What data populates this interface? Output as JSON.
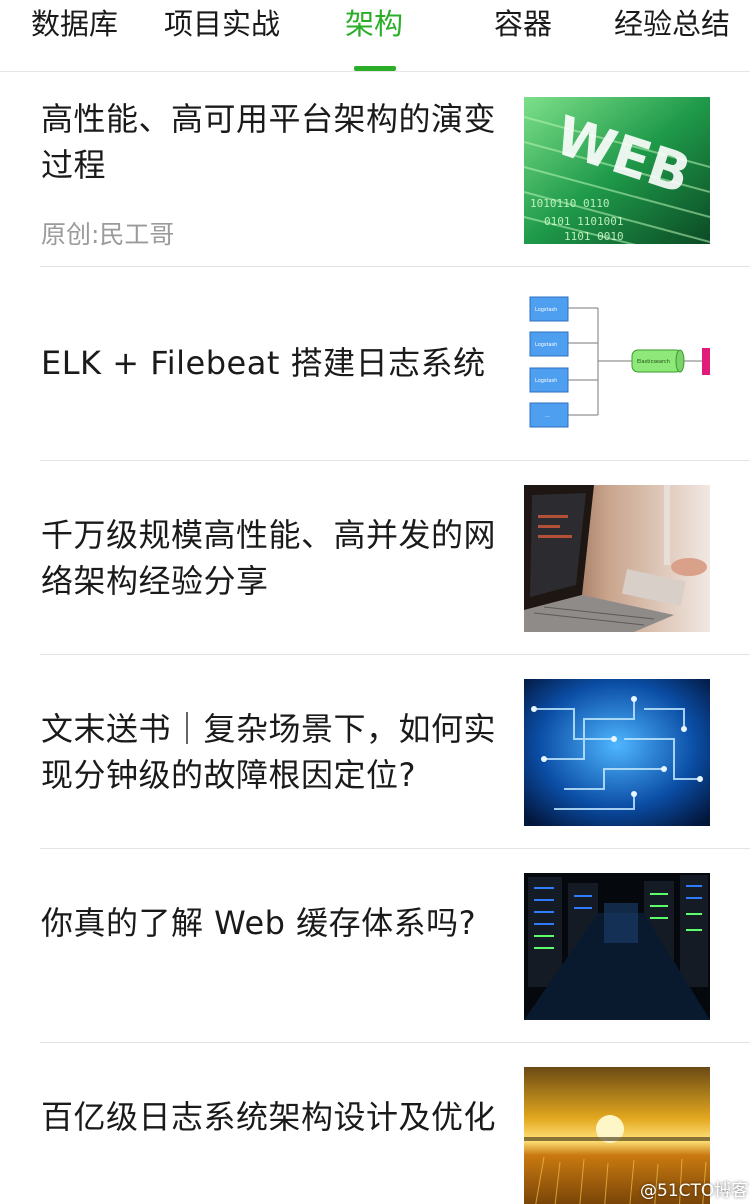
{
  "tabs": [
    {
      "label": "数据库",
      "active": false
    },
    {
      "label": "项目实战",
      "active": false
    },
    {
      "label": "架构",
      "active": true
    },
    {
      "label": "容器",
      "active": false
    },
    {
      "label": "经验总结",
      "active": false
    }
  ],
  "accent_color": "#2aae28",
  "articles": [
    {
      "title": "高性能、高可用平台架构的演变过程",
      "source": "原创:民工哥",
      "thumbnail": "green-web-matrix-image"
    },
    {
      "title": "ELK + Filebeat 搭建日志系统",
      "thumbnail": "logging-diagram-image",
      "diagram_labels": [
        "Logstash",
        "Logstash",
        "Logstash",
        "...",
        "Elasticsearch"
      ]
    },
    {
      "title": "千万级规模高性能、高并发的网络架构经验分享",
      "thumbnail": "laptop-image"
    },
    {
      "title": "文末送书｜复杂场景下，如何实现分钟级的故障根因定位?",
      "thumbnail": "blue-circuit-image"
    },
    {
      "title": "你真的了解 Web 缓存体系吗?",
      "thumbnail": "server-racks-image"
    },
    {
      "title": "百亿级日志系统架构设计及优化",
      "thumbnail": "sunset-field-image"
    }
  ],
  "watermark": "@51CTO博客"
}
